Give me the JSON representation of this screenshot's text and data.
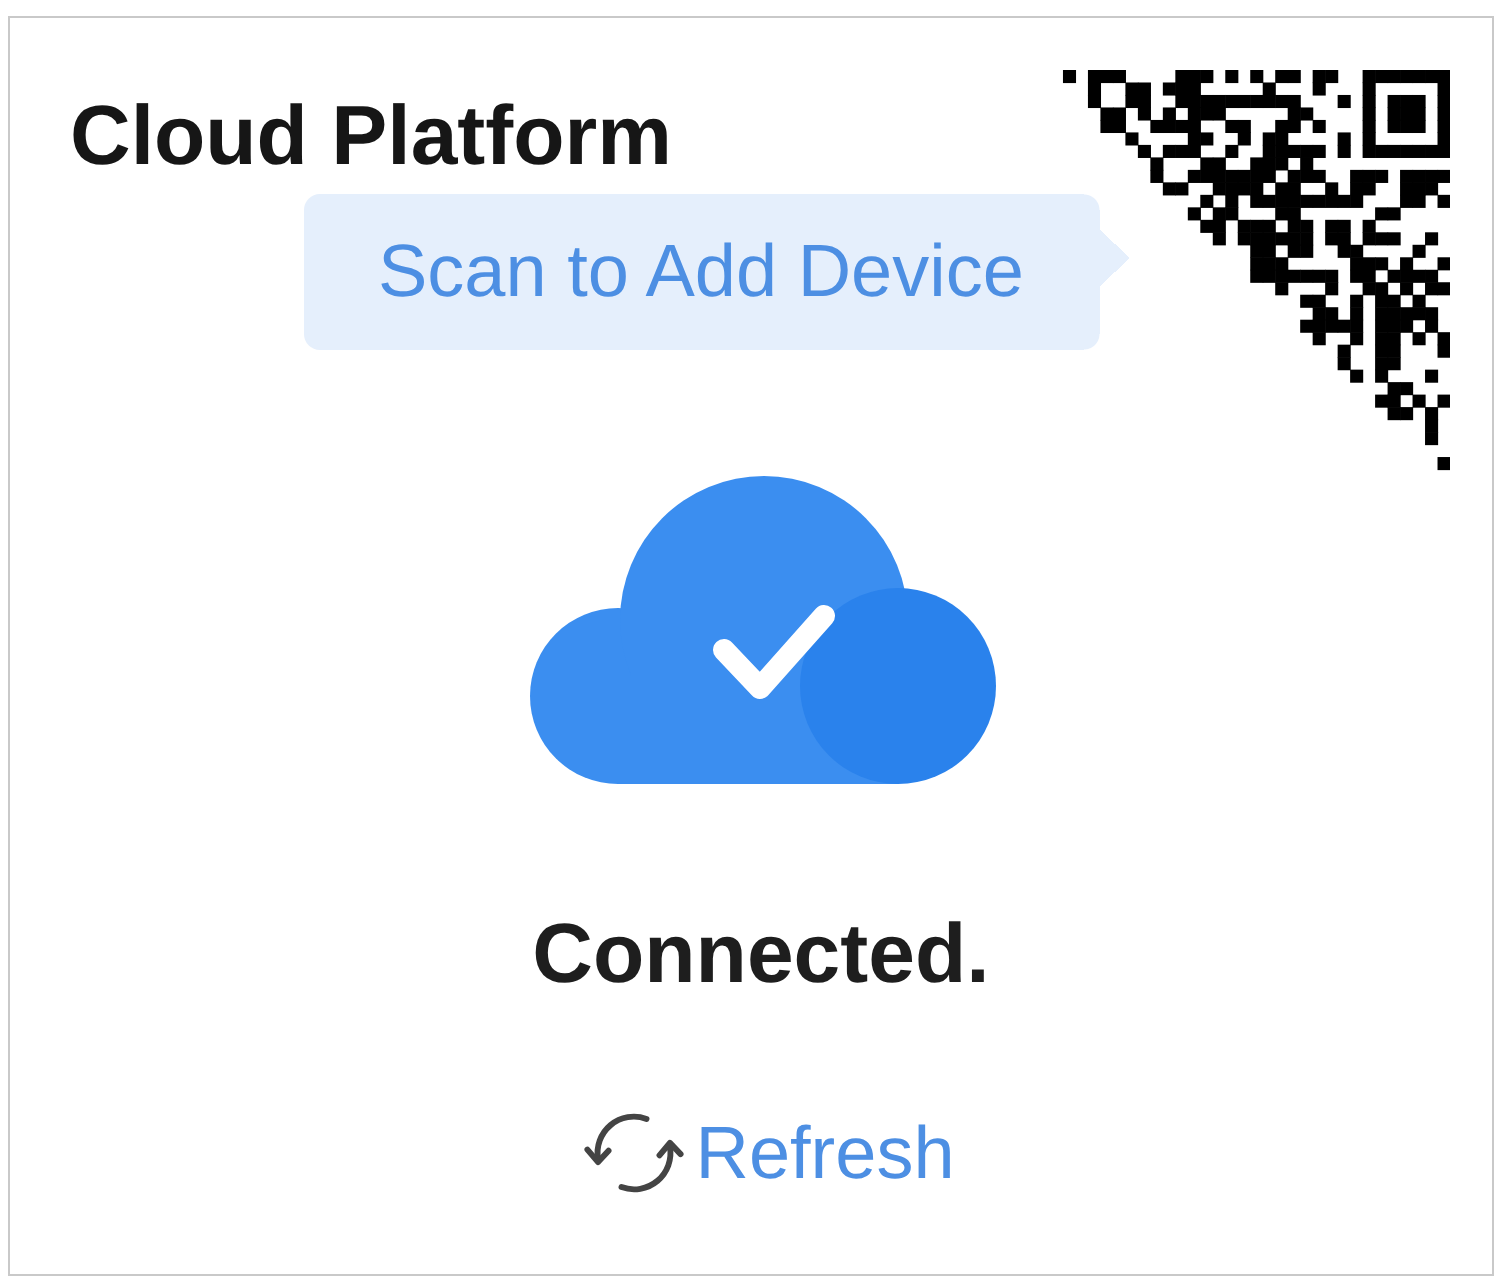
{
  "card": {
    "title": "Cloud Platform",
    "tooltip": "Scan to Add Device",
    "status": {
      "connected": true,
      "text": "Connected."
    },
    "refresh": {
      "label": "Refresh"
    }
  }
}
